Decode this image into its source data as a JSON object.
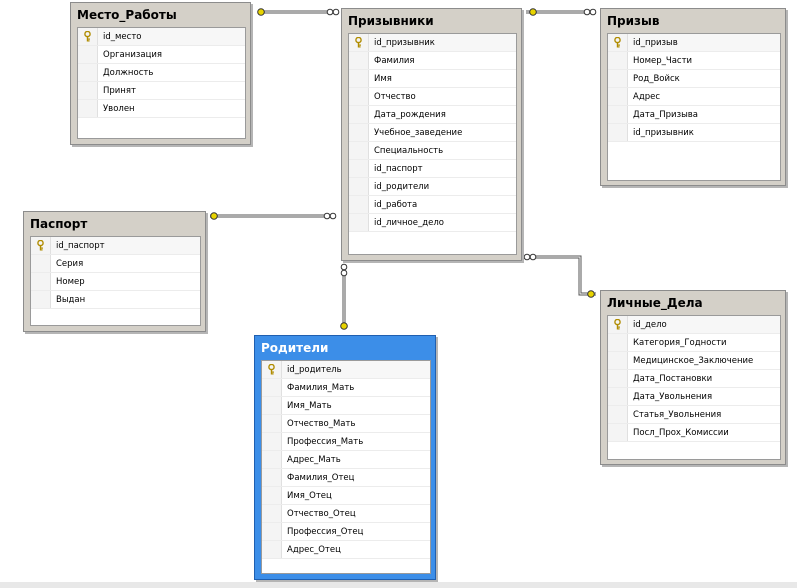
{
  "tables": [
    {
      "id": "mesto",
      "title": "Место_Работы",
      "selected": false,
      "columns": [
        {
          "name": "id_место",
          "pk": true
        },
        {
          "name": "Организация",
          "pk": false
        },
        {
          "name": "Должность",
          "pk": false
        },
        {
          "name": "Принят",
          "pk": false
        },
        {
          "name": "Уволен",
          "pk": false
        }
      ]
    },
    {
      "id": "prizyvniki",
      "title": "Призывники",
      "selected": false,
      "columns": [
        {
          "name": "id_призывник",
          "pk": true
        },
        {
          "name": "Фамилия",
          "pk": false
        },
        {
          "name": "Имя",
          "pk": false
        },
        {
          "name": "Отчество",
          "pk": false
        },
        {
          "name": "Дата_рождения",
          "pk": false
        },
        {
          "name": "Учебное_заведение",
          "pk": false
        },
        {
          "name": "Специальность",
          "pk": false
        },
        {
          "name": "id_паспорт",
          "pk": false
        },
        {
          "name": "id_родители",
          "pk": false
        },
        {
          "name": "id_работа",
          "pk": false
        },
        {
          "name": "id_личное_дело",
          "pk": false
        }
      ]
    },
    {
      "id": "prizyv",
      "title": "Призыв",
      "selected": false,
      "columns": [
        {
          "name": "id_призыв",
          "pk": true
        },
        {
          "name": "Номер_Части",
          "pk": false
        },
        {
          "name": "Род_Войск",
          "pk": false
        },
        {
          "name": "Адрес",
          "pk": false
        },
        {
          "name": "Дата_Призыва",
          "pk": false
        },
        {
          "name": "id_призывник",
          "pk": false
        }
      ]
    },
    {
      "id": "pasport",
      "title": "Паспорт",
      "selected": false,
      "columns": [
        {
          "name": "id_паспорт",
          "pk": true
        },
        {
          "name": "Серия",
          "pk": false
        },
        {
          "name": "Номер",
          "pk": false
        },
        {
          "name": "Выдан",
          "pk": false
        }
      ]
    },
    {
      "id": "lichnye",
      "title": "Личные_Дела",
      "selected": false,
      "columns": [
        {
          "name": "id_дело",
          "pk": true
        },
        {
          "name": "Категория_Годности",
          "pk": false
        },
        {
          "name": "Медицинское_Заключение",
          "pk": false
        },
        {
          "name": "Дата_Постановки",
          "pk": false
        },
        {
          "name": "Дата_Увольнения",
          "pk": false
        },
        {
          "name": "Статья_Увольнения",
          "pk": false
        },
        {
          "name": "Посл_Прох_Комиссии",
          "pk": false
        }
      ]
    },
    {
      "id": "roditeli",
      "title": "Родители",
      "selected": true,
      "columns": [
        {
          "name": "id_родитель",
          "pk": true
        },
        {
          "name": "Фамилия_Мать",
          "pk": false
        },
        {
          "name": "Имя_Мать",
          "pk": false
        },
        {
          "name": "Отчество_Мать",
          "pk": false
        },
        {
          "name": "Профессия_Мать",
          "pk": false
        },
        {
          "name": "Адрес_Мать",
          "pk": false
        },
        {
          "name": "Фамилия_Отец",
          "pk": false
        },
        {
          "name": "Имя_Отец",
          "pk": false
        },
        {
          "name": "Отчество_Отец",
          "pk": false
        },
        {
          "name": "Профессия_Отец",
          "pk": false
        },
        {
          "name": "Адрес_Отец",
          "pk": false
        }
      ]
    }
  ],
  "relationships": [
    {
      "from": "prizyvniki",
      "to": "mesto"
    },
    {
      "from": "prizyvniki",
      "to": "prizyv"
    },
    {
      "from": "prizyvniki",
      "to": "pasport"
    },
    {
      "from": "prizyvniki",
      "to": "roditeli"
    },
    {
      "from": "prizyvniki",
      "to": "lichnye"
    }
  ],
  "colors": {
    "selected_header": "#3c8ee8",
    "table_bg": "#d4d0c8",
    "line": "#555555",
    "key": "#d8b400"
  }
}
